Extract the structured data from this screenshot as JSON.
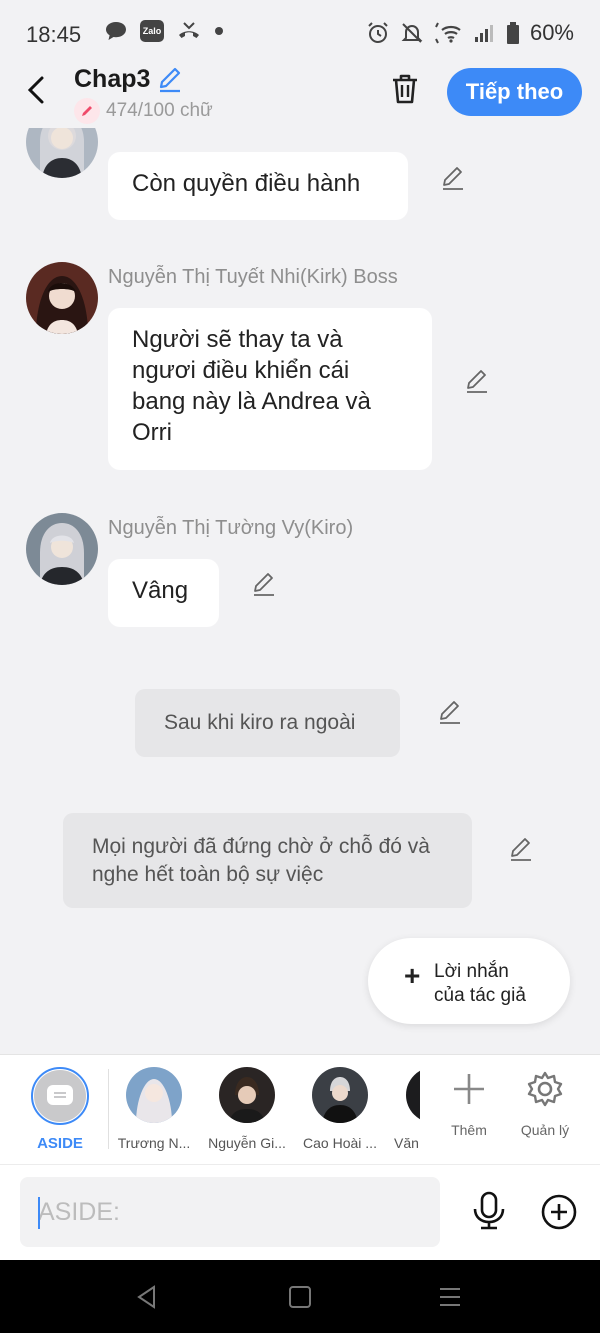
{
  "status_bar": {
    "time": "18:45",
    "battery": "60%",
    "zalo_label": "Zalo"
  },
  "header": {
    "title": "Chap3",
    "word_count": "474/100 chữ",
    "next_button": "Tiếp theo"
  },
  "messages": [
    {
      "type": "character",
      "sender": "",
      "text": "Còn quyền điều hành"
    },
    {
      "type": "character",
      "sender": "Nguyễn Thị Tuyết Nhi(Kirk) Boss",
      "text": "Người sẽ thay ta và ngươi điều khiển cái bang này là Andrea và Orri"
    },
    {
      "type": "character",
      "sender": "Nguyễn Thị Tường Vy(Kiro)",
      "text": "Vâng"
    },
    {
      "type": "aside",
      "text": "Sau khi kiro ra ngoài"
    },
    {
      "type": "aside",
      "text": "Mọi người đã đứng chờ ở chỗ đó và nghe hết toàn bộ sự việc"
    }
  ],
  "author_note": {
    "plus": "+",
    "line1": "Lời nhắn",
    "line2": "của tác giả"
  },
  "characters": [
    {
      "name": "ASIDE"
    },
    {
      "name": "Trương N..."
    },
    {
      "name": "Nguyễn Gi..."
    },
    {
      "name": "Cao Hoài ..."
    },
    {
      "name": "Văn"
    }
  ],
  "tools": {
    "add": "Thêm",
    "manage": "Quản lý"
  },
  "input": {
    "placeholder": "ASIDE:"
  },
  "colors": {
    "accent": "#3d8af7",
    "background": "#f2f2f4"
  }
}
